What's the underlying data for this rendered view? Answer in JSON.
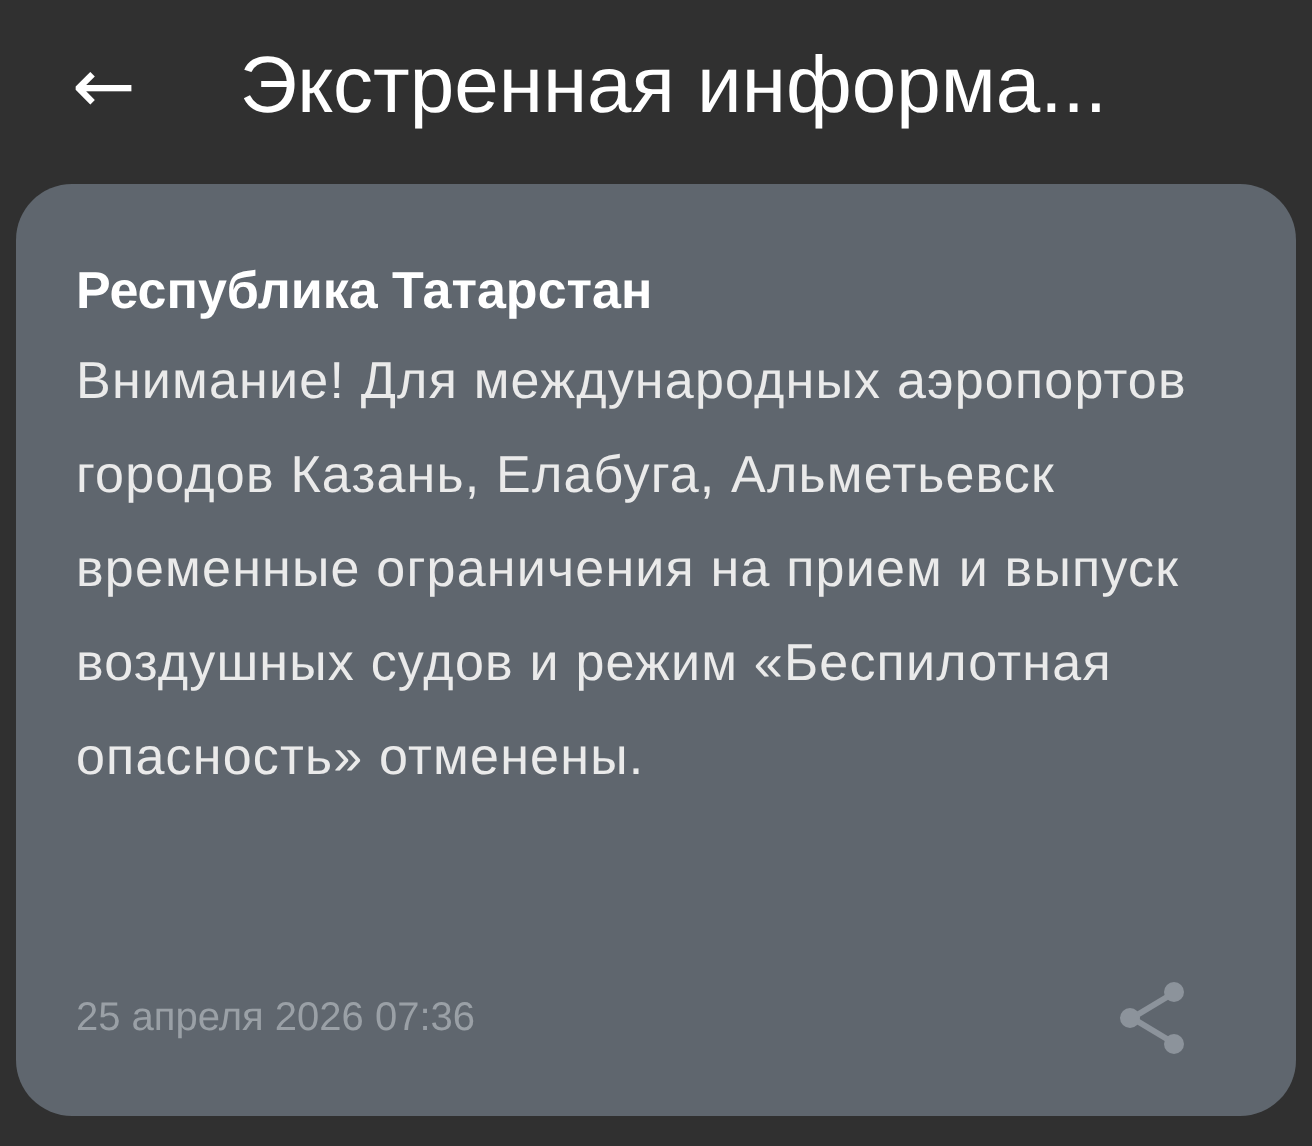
{
  "header": {
    "back_icon": "←",
    "title": "Экстренная информа..."
  },
  "card": {
    "title": "Республика Татарстан",
    "text": "Внимание! Для международных аэропортов городов Казань, Елабуга, Альметьевск временные ограничения на прием и выпуск воздушных судов и режим «Беспилотная опасность» отменены.",
    "date": "25 апреля 2026 07:36"
  }
}
